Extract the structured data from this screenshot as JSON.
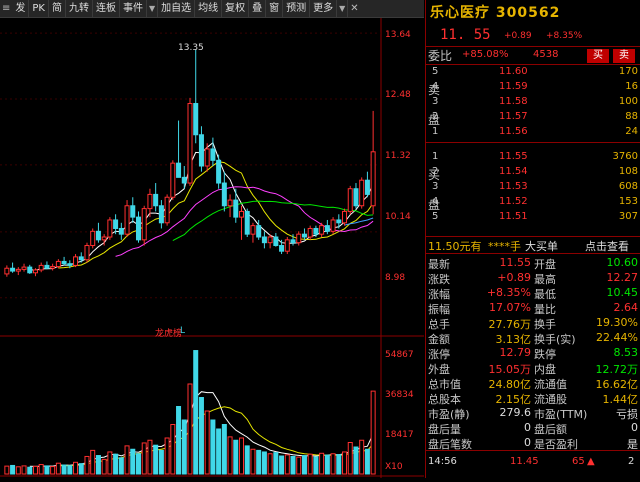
{
  "toolbar": {
    "buttons": [
      "发",
      "PK",
      "简",
      "九转",
      "连板",
      "事件"
    ],
    "buttons2": [
      "加自选",
      "均线",
      "复权",
      "叠",
      "窗",
      "预测",
      "更多"
    ]
  },
  "chart": {
    "y_labels": [
      "13.64",
      "12.48",
      "11.32",
      "10.14",
      "8.98"
    ],
    "peak_label": "13.35",
    "mid_tag": "龙虎榜",
    "mid_L": "L",
    "vol_labels": [
      "54867",
      "36834",
      "18417",
      "X10"
    ]
  },
  "quote": {
    "name": "乐心医疗",
    "code": "300562",
    "price": "11. 55",
    "change": "+0.89",
    "pct": "+8.35%",
    "weibi_label": "委比",
    "weibi_value": "+85.08%",
    "weibi_diff": "4538",
    "buy_btn": "买",
    "sell_btn": "卖"
  },
  "book": {
    "sell_label": [
      "卖",
      "盘"
    ],
    "buy_label": [
      "买",
      "盘"
    ],
    "sells": [
      {
        "level": "5",
        "price": "11.60",
        "vol": "170"
      },
      {
        "level": "4",
        "price": "11.59",
        "vol": "16"
      },
      {
        "level": "3",
        "price": "11.58",
        "vol": "100"
      },
      {
        "level": "2",
        "price": "11.57",
        "vol": "88"
      },
      {
        "level": "1",
        "price": "11.56",
        "vol": "24"
      }
    ],
    "buys": [
      {
        "level": "1",
        "price": "11.55",
        "vol": "3760"
      },
      {
        "level": "2",
        "price": "11.54",
        "vol": "108"
      },
      {
        "level": "3",
        "price": "11.53",
        "vol": "608"
      },
      {
        "level": "4",
        "price": "11.52",
        "vol": "153"
      },
      {
        "level": "5",
        "price": "11.51",
        "vol": "307"
      }
    ]
  },
  "bigbuy": {
    "price": "11.50元有",
    "who": "****手",
    "label": "大买单",
    "link": "点击查看"
  },
  "stats": [
    {
      "l1": "最新",
      "v1": "11.55",
      "c1": "red",
      "l2": "开盘",
      "v2": "10.60",
      "c2": "green"
    },
    {
      "l1": "涨跌",
      "v1": "+0.89",
      "c1": "red",
      "l2": "最高",
      "v2": "12.27",
      "c2": "red"
    },
    {
      "l1": "涨幅",
      "v1": "+8.35%",
      "c1": "red",
      "l2": "最低",
      "v2": "10.45",
      "c2": "green"
    },
    {
      "l1": "振幅",
      "v1": "17.07%",
      "c1": "red",
      "l2": "量比",
      "v2": "2.64",
      "c2": "red"
    },
    {
      "l1": "总手",
      "v1": "27.76万",
      "c1": "yellow",
      "l2": "换手",
      "v2": "19.30%",
      "c2": "yellow"
    },
    {
      "l1": "金额",
      "v1": "3.13亿",
      "c1": "yellow",
      "l2": "换手(实)",
      "v2": "22.44%",
      "c2": "yellow"
    },
    {
      "l1": "涨停",
      "v1": "12.79",
      "c1": "red",
      "l2": "跌停",
      "v2": "8.53",
      "c2": "green"
    },
    {
      "l1": "外盘",
      "v1": "15.05万",
      "c1": "red",
      "l2": "内盘",
      "v2": "12.72万",
      "c2": "green"
    },
    {
      "l1": "总市值",
      "v1": "24.80亿",
      "c1": "yellow",
      "l2": "流通值",
      "v2": "16.62亿",
      "c2": "yellow"
    },
    {
      "l1": "总股本",
      "v1": "2.15亿",
      "c1": "yellow",
      "l2": "流通股",
      "v2": "1.44亿",
      "c2": "yellow"
    },
    {
      "l1": "市盈(静)",
      "v1": "279.6",
      "c1": "white",
      "l2": "市盈(TTM)",
      "v2": "亏损",
      "c2": "white"
    },
    {
      "l1": "盘后量",
      "v1": "0",
      "c1": "white",
      "l2": "盘后额",
      "v2": "0",
      "c2": "white"
    },
    {
      "l1": "盘后笔数",
      "v1": "0",
      "c1": "white",
      "l2": "是否盈利",
      "v2": "是",
      "c2": "white"
    }
  ],
  "tick": {
    "time": "14:56",
    "price": "11.45",
    "vol": "65",
    "arrow": "▲",
    "count": "2"
  },
  "chart_data": {
    "type": "candlestick",
    "candles": [
      [
        9.4,
        9.55,
        9.35,
        9.5
      ],
      [
        9.5,
        9.6,
        9.42,
        9.45
      ],
      [
        9.45,
        9.52,
        9.38,
        9.48
      ],
      [
        9.48,
        9.58,
        9.44,
        9.52
      ],
      [
        9.52,
        9.56,
        9.4,
        9.42
      ],
      [
        9.42,
        9.5,
        9.36,
        9.47
      ],
      [
        9.47,
        9.6,
        9.43,
        9.55
      ],
      [
        9.55,
        9.62,
        9.48,
        9.5
      ],
      [
        9.5,
        9.58,
        9.46,
        9.53
      ],
      [
        9.53,
        9.66,
        9.5,
        9.62
      ],
      [
        9.62,
        9.7,
        9.55,
        9.58
      ],
      [
        9.58,
        9.64,
        9.5,
        9.55
      ],
      [
        9.55,
        9.75,
        9.52,
        9.7
      ],
      [
        9.7,
        9.78,
        9.6,
        9.65
      ],
      [
        9.65,
        9.95,
        9.6,
        9.9
      ],
      [
        9.9,
        10.2,
        9.85,
        10.15
      ],
      [
        10.15,
        10.3,
        9.95,
        10.0
      ],
      [
        10.0,
        10.1,
        9.9,
        10.05
      ],
      [
        10.05,
        10.4,
        10.0,
        10.35
      ],
      [
        10.35,
        10.45,
        10.1,
        10.2
      ],
      [
        10.2,
        10.3,
        10.0,
        10.1
      ],
      [
        10.1,
        10.7,
        10.05,
        10.6
      ],
      [
        10.6,
        10.75,
        10.3,
        10.4
      ],
      [
        10.4,
        10.5,
        9.95,
        10.0
      ],
      [
        10.0,
        10.6,
        9.9,
        10.55
      ],
      [
        10.55,
        10.9,
        10.4,
        10.8
      ],
      [
        10.8,
        11.0,
        10.5,
        10.6
      ],
      [
        10.6,
        10.7,
        10.2,
        10.3
      ],
      [
        10.3,
        10.8,
        10.25,
        10.75
      ],
      [
        10.75,
        11.4,
        10.7,
        11.35
      ],
      [
        11.35,
        12.1,
        11.2,
        11.1
      ],
      [
        11.1,
        11.3,
        10.9,
        11.0
      ],
      [
        11.0,
        12.5,
        10.95,
        12.4
      ],
      [
        12.4,
        13.35,
        11.7,
        11.85
      ],
      [
        11.85,
        12.0,
        11.2,
        11.3
      ],
      [
        11.3,
        11.7,
        11.2,
        11.6
      ],
      [
        11.6,
        11.8,
        11.3,
        11.4
      ],
      [
        11.4,
        11.5,
        10.9,
        11.0
      ],
      [
        11.0,
        11.2,
        10.5,
        10.6
      ],
      [
        10.6,
        10.8,
        10.4,
        10.7
      ],
      [
        10.7,
        10.9,
        10.3,
        10.4
      ],
      [
        10.4,
        10.6,
        10.0,
        10.5
      ],
      [
        10.5,
        10.55,
        10.05,
        10.1
      ],
      [
        10.1,
        10.3,
        9.95,
        10.25
      ],
      [
        10.25,
        10.35,
        10.0,
        10.05
      ],
      [
        10.05,
        10.15,
        9.85,
        9.95
      ],
      [
        9.95,
        10.1,
        9.85,
        10.05
      ],
      [
        10.05,
        10.12,
        9.88,
        9.9
      ],
      [
        9.9,
        10.0,
        9.75,
        9.8
      ],
      [
        9.8,
        10.05,
        9.75,
        10.0
      ],
      [
        10.0,
        10.1,
        9.9,
        9.95
      ],
      [
        9.95,
        10.15,
        9.9,
        10.1
      ],
      [
        10.1,
        10.2,
        10.0,
        10.05
      ],
      [
        10.05,
        10.25,
        10.0,
        10.2
      ],
      [
        10.2,
        10.25,
        10.05,
        10.1
      ],
      [
        10.1,
        10.3,
        10.05,
        10.25
      ],
      [
        10.25,
        10.35,
        10.1,
        10.15
      ],
      [
        10.15,
        10.4,
        10.1,
        10.35
      ],
      [
        10.35,
        10.45,
        10.2,
        10.3
      ],
      [
        10.3,
        10.55,
        10.25,
        10.5
      ],
      [
        10.5,
        10.95,
        10.45,
        10.9
      ],
      [
        10.9,
        11.0,
        10.55,
        10.6
      ],
      [
        10.6,
        11.1,
        10.55,
        11.05
      ],
      [
        11.05,
        11.2,
        10.75,
        10.8
      ],
      [
        10.6,
        12.27,
        10.45,
        11.55
      ]
    ],
    "volume": [
      3500,
      3800,
      3200,
      3600,
      3000,
      3400,
      4200,
      3600,
      3300,
      4800,
      4000,
      3700,
      5200,
      4600,
      7800,
      10500,
      8200,
      6500,
      9800,
      8800,
      7200,
      12500,
      11000,
      9000,
      13800,
      15000,
      12800,
      10500,
      16000,
      22000,
      30000,
      24000,
      40000,
      54867,
      34000,
      28000,
      24000,
      20000,
      22000,
      16500,
      15000,
      16000,
      12500,
      11000,
      10500,
      9800,
      9000,
      9500,
      8000,
      8500,
      7800,
      7500,
      8200,
      8800,
      7600,
      9200,
      8400,
      9000,
      8600,
      9800,
      14000,
      12000,
      15000,
      11000,
      36834
    ]
  }
}
